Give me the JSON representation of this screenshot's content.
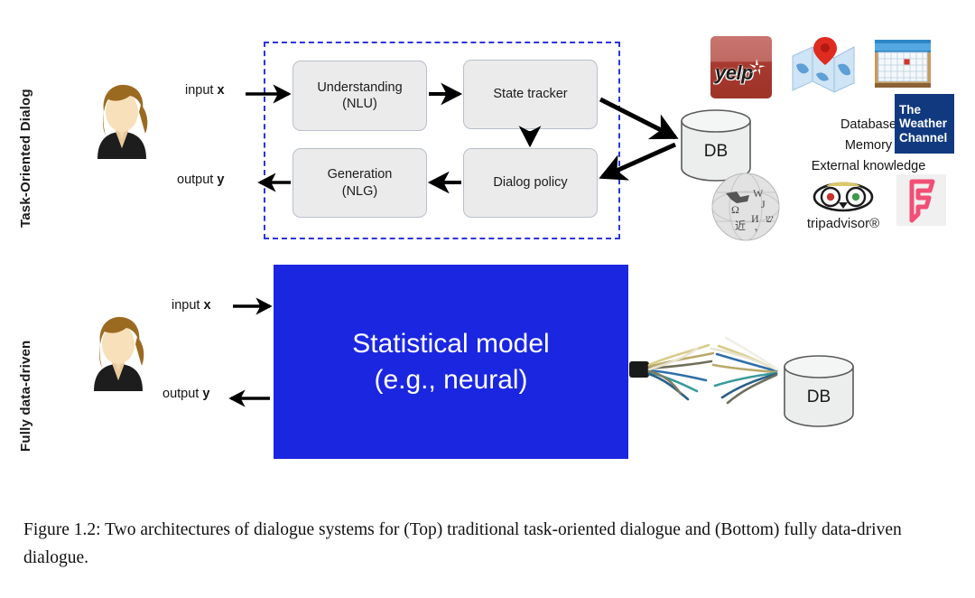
{
  "figure": {
    "rows": [
      {
        "id": "task-oriented",
        "label": "Task-Oriented Dialog"
      },
      {
        "id": "fully-data-driven",
        "label": "Fully data-driven"
      }
    ],
    "io": {
      "input_prefix": "input ",
      "input_var": "x",
      "output_prefix": "output ",
      "output_var": "y"
    },
    "pipeline": {
      "modules": [
        {
          "id": "nlu",
          "line1": "Understanding",
          "line2": "(NLU)"
        },
        {
          "id": "state-tracker",
          "line1": "State tracker",
          "line2": ""
        },
        {
          "id": "nlg",
          "line1": "Generation",
          "line2": "(NLG)"
        },
        {
          "id": "dialog-policy",
          "line1": "Dialog policy",
          "line2": ""
        }
      ],
      "border_color": "#2b35dd",
      "module_fill": "#ebebeb"
    },
    "statistical_model": {
      "line1": "Statistical model",
      "line2": "(e.g., neural)",
      "fill": "#1a26e0",
      "text_color": "#ffffff"
    },
    "database": {
      "label": "DB"
    },
    "external_sources": {
      "lines": [
        "Database",
        "Memory",
        "External knowledge"
      ],
      "logos": [
        {
          "id": "yelp",
          "name": "yelp-logo",
          "text": "yelp",
          "color": "#a83a30"
        },
        {
          "id": "map",
          "name": "map-logo",
          "text": "",
          "color": "#3f8fd0"
        },
        {
          "id": "calendar",
          "name": "calendar-logo",
          "text": "",
          "color": "#3a7fc4"
        },
        {
          "id": "weather",
          "name": "weather-channel-logo",
          "line1": "The",
          "line2": "Weather",
          "line3": "Channel",
          "color": "#11397f"
        },
        {
          "id": "wikipedia",
          "name": "wikipedia-logo",
          "text": "",
          "color": "#dddddd"
        },
        {
          "id": "tripadvisor",
          "name": "tripadvisor-logo",
          "text": "tripadvisor®",
          "color": "#1b1b1b"
        },
        {
          "id": "foursquare",
          "name": "foursquare-logo",
          "text": "F",
          "color": "#f24f76"
        }
      ]
    }
  },
  "caption": {
    "text": "Figure 1.2: Two architectures of dialogue systems for (Top) traditional task-oriented dialogue and (Bottom) fully data-driven dialogue."
  }
}
